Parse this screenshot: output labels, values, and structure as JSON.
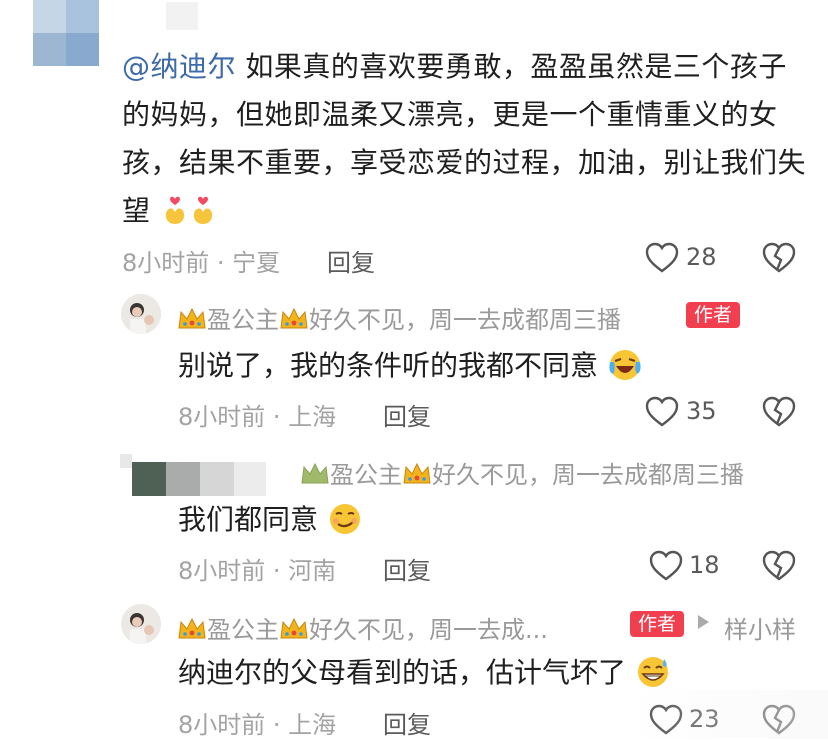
{
  "main_comment": {
    "mention": "@纳迪尔",
    "text": " 如果真的喜欢要勇敢，盈盈虽然是三个孩子的妈妈，但她即温柔又漂亮，更是一个重情重义的女孩，结果不重要，享受恋爱的过程，加油，别让我们失望",
    "emoji": [
      "heart-hands-icon",
      "heart-hands-icon"
    ],
    "time_location": "8小时前 · 宁夏",
    "reply_label": "回复",
    "like_count": "28"
  },
  "reply1": {
    "name_prefix": "盈公主",
    "name_suffix": "好久不见，周一去成都周三播",
    "badge": "作者",
    "text": "别说了，我的条件听的我都不同意",
    "emoji": "laughing-crying-icon",
    "time_location": "8小时前 · 上海",
    "reply_label": "回复",
    "like_count": "35"
  },
  "reply2": {
    "name_prefix": "盈公主",
    "name_suffix": "好久不见，周一去成都周三播",
    "text": "我们都同意",
    "emoji": "smirk-icon",
    "time_location": "8小时前 · 河南",
    "reply_label": "回复",
    "like_count": "18"
  },
  "reply3": {
    "name_prefix": "盈公主",
    "name_suffix": "好久不见，周一去成...",
    "badge": "作者",
    "reply_to": "样小样",
    "text": "纳迪尔的父母看到的话，估计气坏了",
    "emoji": "grin-sweat-icon",
    "time_location": "8小时前 · 上海",
    "reply_label": "回复",
    "like_count": "23"
  },
  "colors": {
    "mention": "#3d6aa8",
    "badge": "#f23f4f",
    "meta": "#a3a3a3"
  }
}
